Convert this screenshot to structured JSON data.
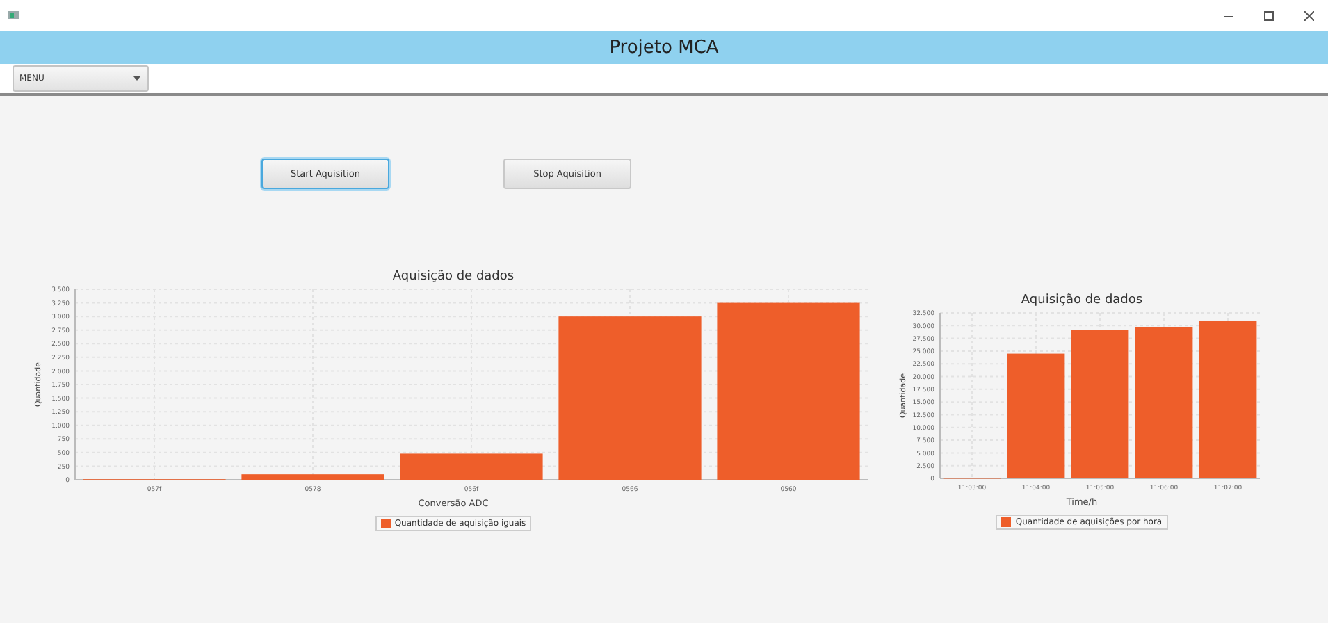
{
  "window": {
    "title": "Projeto MCA"
  },
  "menu": {
    "label": "MENU"
  },
  "buttons": [
    {
      "label": "Start Aquisition",
      "focused": true
    },
    {
      "label": "Stop Aquisition",
      "focused": false
    }
  ],
  "charts": [
    {
      "chart_data": {
        "type": "bar",
        "grid": true,
        "title": "Aquisição de dados",
        "xlabel": "Conversão ADC",
        "ylabel": "Quantidade",
        "categories": [
          "057f",
          "0578",
          "056f",
          "0566",
          "0560"
        ],
        "series": [
          {
            "name": "Quantidade de aquisição iguais",
            "color": "#ee5e2a",
            "values": [
              10,
              100,
              480,
              3000,
              3250
            ]
          }
        ],
        "ylim": [
          0,
          3500
        ],
        "yticks": [
          {
            "value": 0,
            "label": "0"
          },
          {
            "value": 250,
            "label": "250"
          },
          {
            "value": 500,
            "label": "500"
          },
          {
            "value": 750,
            "label": "750"
          },
          {
            "value": 1000,
            "label": "1.000"
          },
          {
            "value": 1250,
            "label": "1.250"
          },
          {
            "value": 1500,
            "label": "1.500"
          },
          {
            "value": 1750,
            "label": "1.750"
          },
          {
            "value": 2000,
            "label": "2.000"
          },
          {
            "value": 2250,
            "label": "2.250"
          },
          {
            "value": 2500,
            "label": "2.500"
          },
          {
            "value": 2750,
            "label": "2.750"
          },
          {
            "value": 3000,
            "label": "3.000"
          },
          {
            "value": 3250,
            "label": "3.250"
          },
          {
            "value": 3500,
            "label": "3.500"
          }
        ]
      }
    },
    {
      "chart_data": {
        "type": "bar",
        "grid": true,
        "title": "Aquisição de dados",
        "xlabel": "Time/h",
        "ylabel": "Quantidade",
        "categories": [
          "11:03:00",
          "11:04:00",
          "11:05:00",
          "11:06:00",
          "11:07:00"
        ],
        "series": [
          {
            "name": "Quantidade de aquisições por hora",
            "color": "#ee5e2a",
            "values": [
              100,
              24500,
              29200,
              29700,
              31000
            ]
          }
        ],
        "ylim": [
          0,
          32500
        ],
        "yticks": [
          {
            "value": 0,
            "label": "0"
          },
          {
            "value": 2500,
            "label": "2.500"
          },
          {
            "value": 5000,
            "label": "5.000"
          },
          {
            "value": 7500,
            "label": "7.500"
          },
          {
            "value": 10000,
            "label": "10.000"
          },
          {
            "value": 12500,
            "label": "12.500"
          },
          {
            "value": 15000,
            "label": "15.000"
          },
          {
            "value": 17500,
            "label": "17.500"
          },
          {
            "value": 20000,
            "label": "20.000"
          },
          {
            "value": 22500,
            "label": "22.500"
          },
          {
            "value": 25000,
            "label": "25.000"
          },
          {
            "value": 27500,
            "label": "27.500"
          },
          {
            "value": 30000,
            "label": "30.000"
          },
          {
            "value": 32500,
            "label": "32.500"
          }
        ]
      }
    }
  ]
}
